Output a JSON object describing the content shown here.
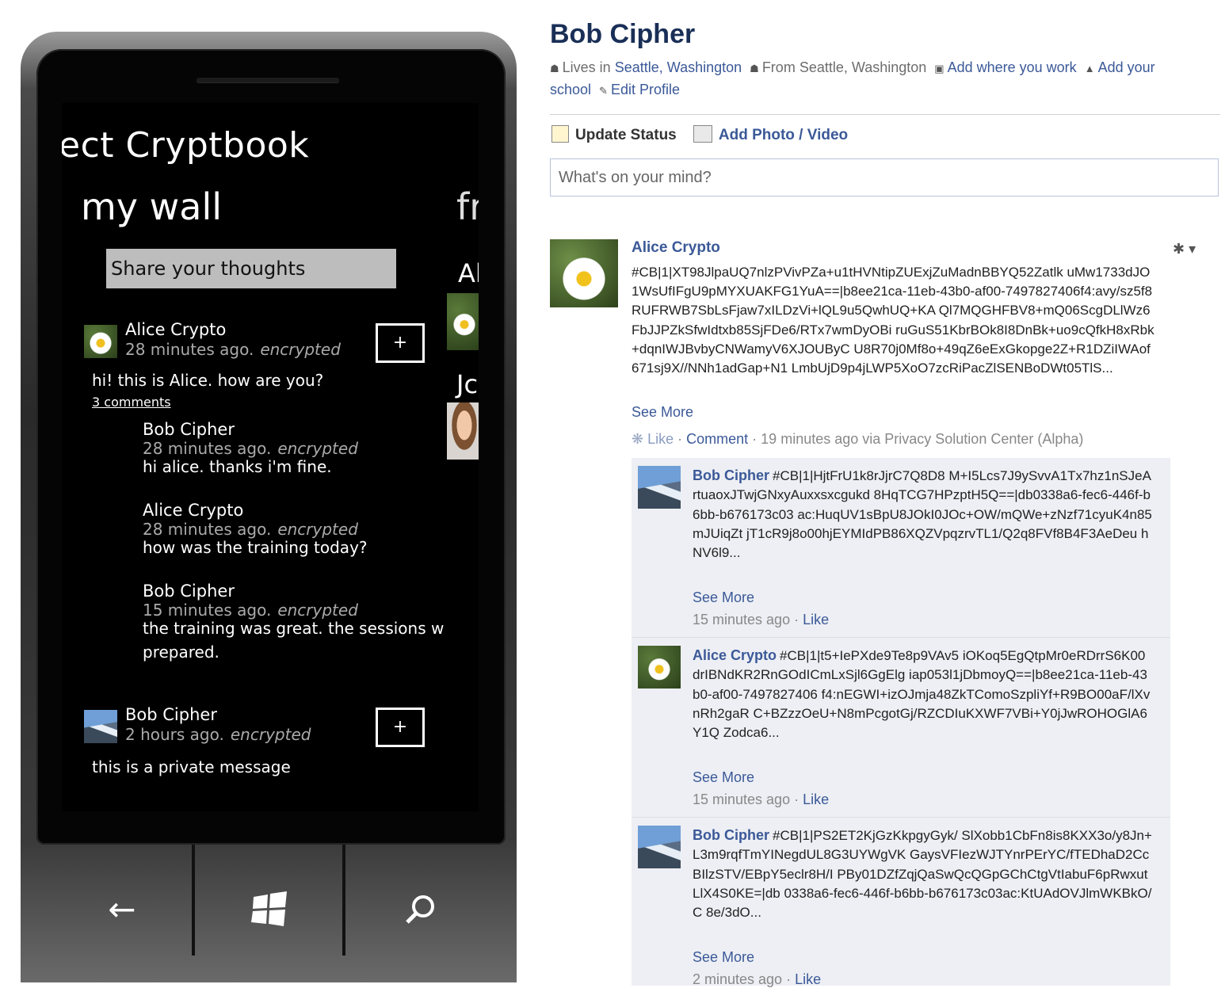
{
  "phone": {
    "app_title": "ect Cryptbook",
    "pivot_current": "my wall",
    "pivot_next": "fr",
    "share_placeholder": "Share your thoughts",
    "side_names": [
      "Al",
      "Jc"
    ],
    "posts": [
      {
        "author": "Alice Crypto",
        "time": "28 minutes ago.",
        "status": "encrypted",
        "text": "hi! this is Alice. how are you?",
        "comments_link": "3 comments",
        "plus": "+"
      },
      {
        "author": "Bob Cipher",
        "time": "2 hours ago.",
        "status": "encrypted",
        "text": "this is a private message",
        "plus": "+"
      }
    ],
    "comments": [
      {
        "author": "Bob Cipher",
        "time": "28 minutes ago.",
        "status": "encrypted",
        "text": "hi alice. thanks i'm fine."
      },
      {
        "author": "Alice Crypto",
        "time": "28 minutes ago.",
        "status": "encrypted",
        "text": "how was the training today?"
      },
      {
        "author": "Bob Cipher",
        "time": "15 minutes ago.",
        "status": "encrypted",
        "text": "the training was great. the sessions w",
        "text2": "prepared."
      }
    ],
    "hw": {
      "back": "←",
      "start": "start-icon",
      "search": "search-icon"
    }
  },
  "fb": {
    "profile_name": "Bob Cipher",
    "info": {
      "lives": "Lives in",
      "lives_city": "Seattle, Washington",
      "from": "From",
      "from_city": "Seattle, Washington",
      "work": "Add where you work",
      "school_a": "Add your",
      "school_b": "school",
      "edit": "Edit Profile"
    },
    "update_status": "Update Status",
    "add_photo": "Add Photo / Video",
    "mind_placeholder": "What's on your mind?",
    "post": {
      "author": "Alice Crypto",
      "cipher": "#CB|1|XT98JlpaUQ7nlzPVivPZa+u1tHVNtipZUExjZuMadnBBYQ52Zatlk uMw1733dJO1WsUfIFgU9pMYXUAKFG1YuA==|b8ee21ca-11eb-43b0-af00-7497827406f4:avy/sz5f8RUFRWB7SbLsFjaw7xILDzVi+lQL9u5QwhUQ+KA Ql7MQGHFBV8+mQ06ScgDLlWz6FbJJPZkSfwIdtxb85SjFDe6/RTx7wmDyOBi ruGuS51KbrBOk8I8DnBk+uo9cQfkH8xRbk+dqnIWJBvbyCNWamyV6XJOUByC U8R70j0Mf8o+49qZ6eExGkopge2Z+R1DZiIWAof671sj9X//NNh1adGap+N1 LmbUjD9p4jLWP5XoO7zcRiPacZlSENBoDWt05TlS...",
      "see_more": "See More",
      "like": "Like",
      "comment": "Comment",
      "time_via": "19 minutes ago via Privacy Solution Center (Alpha)"
    },
    "comments": [
      {
        "author": "Bob Cipher",
        "cipher": "#CB|1|HjtFrU1k8rJjrC7Q8D8 M+I5Lcs7J9ySvvA1Tx7hz1nSJeArtuaoxJTwjGNxyAuxxsxcgukd 8HqTCG7HPzptH5Q==|db0338a6-fec6-446f-b6bb-b676173c03 ac:HuqUV1sBpU8JOkI0JOc+OW/mQWe+zNzf71cyuK4n85mJUiqZt jT1cR9j8o00hjEYMIdPB86XQZVpqzrvTL1/Q2q8FVf8B4F3AeDeu hNV6l9...",
        "see_more": "See More",
        "time": "15 minutes ago",
        "like": "Like"
      },
      {
        "author": "Alice Crypto",
        "cipher": "#CB|1|t5+IePXde9Te8p9VAv5 iOKoq5EgQtpMr0eRDrrS6K00drIBNdKR2RnGOdICmLxSjl6GgElg iap053l1jDbmoyQ==|b8ee21ca-11eb-43b0-af00-7497827406 f4:nEGWI+izOJmja48ZkTComoSzpliYf+R9BO00aF/lXvnRh2gaR C+BZzzOeU+N8mPcgotGj/RZCDIuKXWF7VBi+Y0jJwROHOGlA6Y1Q Zodca6...",
        "see_more": "See More",
        "time": "15 minutes ago",
        "like": "Like"
      },
      {
        "author": "Bob Cipher",
        "cipher": "#CB|1|PS2ET2KjGzKkpgyGyk/ SlXobb1CbFn8is8KXX3o/y8Jn+L3m9rqfTmYINegdUL8G3UYWgVK GaysVFIezWJTYnrPErYC/fTEDhaD2CcBIlzSTV/EBpY5eclr8H/I PBy01DZfZqjQaSwQcQGpGChCtgVtIabuF6pRwxutLlX4S0KE=|db 0338a6-fec6-446f-b6bb-b676173c03ac:KtUAdOVJlmWKBkO/C 8e/3dO...",
        "see_more": "See More",
        "time": "2 minutes ago",
        "like": "Like"
      }
    ]
  }
}
